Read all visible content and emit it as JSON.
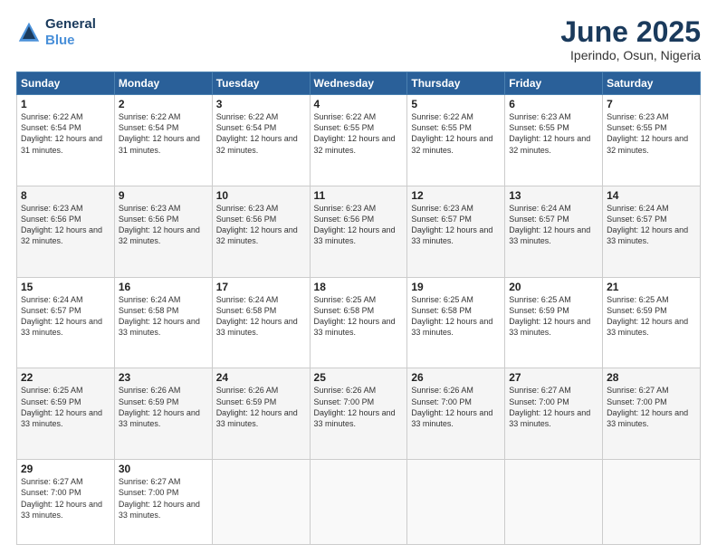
{
  "header": {
    "logo_line1": "General",
    "logo_line2": "Blue",
    "month": "June 2025",
    "location": "Iperindo, Osun, Nigeria"
  },
  "days_of_week": [
    "Sunday",
    "Monday",
    "Tuesday",
    "Wednesday",
    "Thursday",
    "Friday",
    "Saturday"
  ],
  "weeks": [
    [
      {
        "day": "1",
        "sunrise": "6:22 AM",
        "sunset": "6:54 PM",
        "daylight": "12 hours and 31 minutes."
      },
      {
        "day": "2",
        "sunrise": "6:22 AM",
        "sunset": "6:54 PM",
        "daylight": "12 hours and 31 minutes."
      },
      {
        "day": "3",
        "sunrise": "6:22 AM",
        "sunset": "6:54 PM",
        "daylight": "12 hours and 32 minutes."
      },
      {
        "day": "4",
        "sunrise": "6:22 AM",
        "sunset": "6:55 PM",
        "daylight": "12 hours and 32 minutes."
      },
      {
        "day": "5",
        "sunrise": "6:22 AM",
        "sunset": "6:55 PM",
        "daylight": "12 hours and 32 minutes."
      },
      {
        "day": "6",
        "sunrise": "6:23 AM",
        "sunset": "6:55 PM",
        "daylight": "12 hours and 32 minutes."
      },
      {
        "day": "7",
        "sunrise": "6:23 AM",
        "sunset": "6:55 PM",
        "daylight": "12 hours and 32 minutes."
      }
    ],
    [
      {
        "day": "8",
        "sunrise": "6:23 AM",
        "sunset": "6:56 PM",
        "daylight": "12 hours and 32 minutes."
      },
      {
        "day": "9",
        "sunrise": "6:23 AM",
        "sunset": "6:56 PM",
        "daylight": "12 hours and 32 minutes."
      },
      {
        "day": "10",
        "sunrise": "6:23 AM",
        "sunset": "6:56 PM",
        "daylight": "12 hours and 32 minutes."
      },
      {
        "day": "11",
        "sunrise": "6:23 AM",
        "sunset": "6:56 PM",
        "daylight": "12 hours and 33 minutes."
      },
      {
        "day": "12",
        "sunrise": "6:23 AM",
        "sunset": "6:57 PM",
        "daylight": "12 hours and 33 minutes."
      },
      {
        "day": "13",
        "sunrise": "6:24 AM",
        "sunset": "6:57 PM",
        "daylight": "12 hours and 33 minutes."
      },
      {
        "day": "14",
        "sunrise": "6:24 AM",
        "sunset": "6:57 PM",
        "daylight": "12 hours and 33 minutes."
      }
    ],
    [
      {
        "day": "15",
        "sunrise": "6:24 AM",
        "sunset": "6:57 PM",
        "daylight": "12 hours and 33 minutes."
      },
      {
        "day": "16",
        "sunrise": "6:24 AM",
        "sunset": "6:58 PM",
        "daylight": "12 hours and 33 minutes."
      },
      {
        "day": "17",
        "sunrise": "6:24 AM",
        "sunset": "6:58 PM",
        "daylight": "12 hours and 33 minutes."
      },
      {
        "day": "18",
        "sunrise": "6:25 AM",
        "sunset": "6:58 PM",
        "daylight": "12 hours and 33 minutes."
      },
      {
        "day": "19",
        "sunrise": "6:25 AM",
        "sunset": "6:58 PM",
        "daylight": "12 hours and 33 minutes."
      },
      {
        "day": "20",
        "sunrise": "6:25 AM",
        "sunset": "6:59 PM",
        "daylight": "12 hours and 33 minutes."
      },
      {
        "day": "21",
        "sunrise": "6:25 AM",
        "sunset": "6:59 PM",
        "daylight": "12 hours and 33 minutes."
      }
    ],
    [
      {
        "day": "22",
        "sunrise": "6:25 AM",
        "sunset": "6:59 PM",
        "daylight": "12 hours and 33 minutes."
      },
      {
        "day": "23",
        "sunrise": "6:26 AM",
        "sunset": "6:59 PM",
        "daylight": "12 hours and 33 minutes."
      },
      {
        "day": "24",
        "sunrise": "6:26 AM",
        "sunset": "6:59 PM",
        "daylight": "12 hours and 33 minutes."
      },
      {
        "day": "25",
        "sunrise": "6:26 AM",
        "sunset": "7:00 PM",
        "daylight": "12 hours and 33 minutes."
      },
      {
        "day": "26",
        "sunrise": "6:26 AM",
        "sunset": "7:00 PM",
        "daylight": "12 hours and 33 minutes."
      },
      {
        "day": "27",
        "sunrise": "6:27 AM",
        "sunset": "7:00 PM",
        "daylight": "12 hours and 33 minutes."
      },
      {
        "day": "28",
        "sunrise": "6:27 AM",
        "sunset": "7:00 PM",
        "daylight": "12 hours and 33 minutes."
      }
    ],
    [
      {
        "day": "29",
        "sunrise": "6:27 AM",
        "sunset": "7:00 PM",
        "daylight": "12 hours and 33 minutes."
      },
      {
        "day": "30",
        "sunrise": "6:27 AM",
        "sunset": "7:00 PM",
        "daylight": "12 hours and 33 minutes."
      },
      null,
      null,
      null,
      null,
      null
    ]
  ]
}
